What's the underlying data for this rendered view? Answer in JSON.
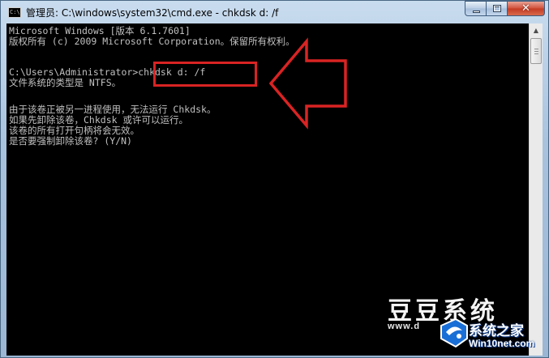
{
  "window": {
    "title": "管理员: C:\\windows\\system32\\cmd.exe - chkdsk  d: /f",
    "icon": "cmd-icon",
    "controls": {
      "minimize": "minimize-icon",
      "maximize": "maximize-icon",
      "close_glyph": "✕"
    }
  },
  "console": {
    "lines": [
      "Microsoft Windows [版本 6.1.7601]",
      "版权所有 (c) 2009 Microsoft Corporation。保留所有权利。",
      "",
      "C:\\Users\\Administrator>chkdsk d: /f",
      "文件系统的类型是 NTFS。",
      "",
      "由于该卷正被另一进程使用，无法运行 Chkdsk。",
      "如果先卸除该卷，Chkdsk 或许可以运行。",
      "该卷的所有打开句柄将会无效。",
      "是否要强制卸除该卷? (Y/N)"
    ]
  },
  "annotation": {
    "color": "#d92323"
  },
  "watermark": {
    "text": "豆豆系统",
    "url": "www.d"
  },
  "logo": {
    "name": "系统之家",
    "url": "Win10net.com",
    "color": "#1a6fd6"
  }
}
